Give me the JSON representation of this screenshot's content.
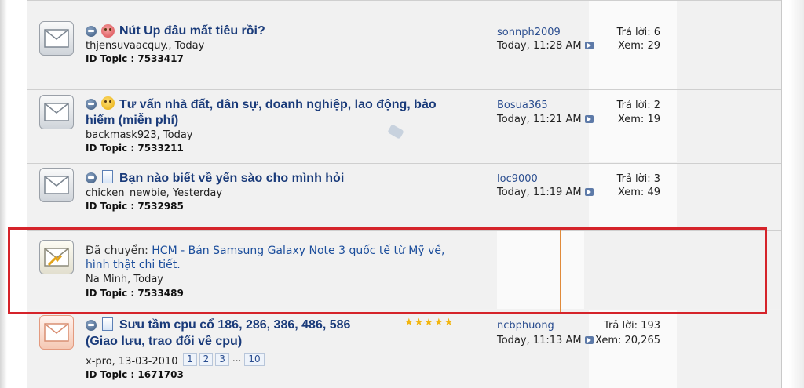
{
  "threads": [
    {
      "title": "Nút Up đâu mất tiêu rồi?",
      "starter": "thjensuvaacquy., Today",
      "id_topic": "ID Topic : 7533417",
      "last_user": "sonnph2009",
      "last_time": "Today, 11:28 AM",
      "replies": "Trả lời: 6",
      "views": "Xem: 29"
    },
    {
      "title_line1": "Tư vấn nhà đất, dân sự, doanh nghiệp, lao động, bảo",
      "title_line2": "hiểm (miễn phí)",
      "starter": "backmask923, Today",
      "id_topic": "ID Topic : 7533211",
      "last_user": "Bosua365",
      "last_time": "Today, 11:21 AM",
      "replies": "Trả lời: 2",
      "views": "Xem: 19"
    },
    {
      "title": "Bạn nào biết về yến sào cho mình hỏi",
      "starter": "chicken_newbie, Yesterday",
      "id_topic": "ID Topic : 7532985",
      "last_user": "loc9000",
      "last_time": "Today, 11:19 AM",
      "replies": "Trả lời: 3",
      "views": "Xem: 49"
    },
    {
      "moved_prefix": "Đã chuyển: ",
      "moved_link_line1": "HCM - Bán Samsung Galaxy Note 3 quốc tế từ Mỹ về,",
      "moved_link_line2": "hình thật chi tiết.",
      "starter": "Na Minh, Today",
      "id_topic": "ID Topic : 7533489"
    },
    {
      "title_line1": "Sưu tầm cpu cổ 186, 286, 386, 486, 586",
      "title_line2": "(Giao lưu, trao đổi về cpu)",
      "starter": "x-pro, 13-03-2010",
      "rating_stars": 5,
      "pages": [
        "1",
        "2",
        "3",
        "...",
        "10"
      ],
      "id_topic": "ID Topic : 1671703",
      "last_user": "ncbphuong",
      "last_time": "Today, 11:13 AM",
      "replies": "Trả lời: 193",
      "views": "Xem: 20,265"
    }
  ],
  "icons": {
    "thread": "envelope-icon",
    "status": "status-dot-icon",
    "goto": "goto-last-post-icon",
    "tag": "tag-icon"
  },
  "colors": {
    "highlight_border": "#d5232a",
    "title": "#1a3b7a",
    "link": "#1c4e9c",
    "stars": "#f2b510"
  }
}
